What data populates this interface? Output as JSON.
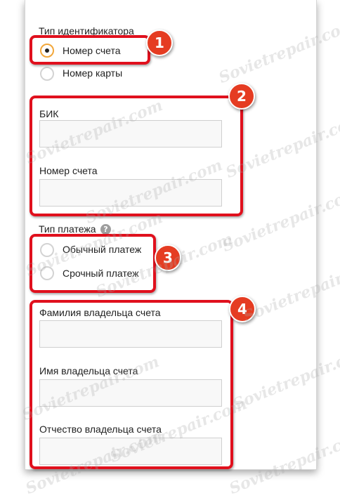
{
  "identifier_type": {
    "label": "Тип идентификатора",
    "options": [
      "Номер счета",
      "Номер карты"
    ],
    "selected": "Номер счета"
  },
  "bank_details": {
    "bik_label": "БИК",
    "bik_value": "",
    "account_label": "Номер счета",
    "account_value": ""
  },
  "payment_type": {
    "label": "Тип платежа",
    "help_glyph": "?",
    "options": [
      "Обычный платеж",
      "Срочный платеж"
    ]
  },
  "owner": {
    "last_name_label": "Фамилия владельца счета",
    "first_name_label": "Имя владельца счета",
    "patronymic_label": "Отчество владельца счета",
    "last_name_value": "",
    "first_name_value": "",
    "patronymic_value": ""
  },
  "callouts": [
    "1",
    "2",
    "3",
    "4"
  ],
  "watermark": "Sovietrepair.com",
  "colors": {
    "highlight": "#e0101d",
    "badge": "#e53c22",
    "radio_checked": "#f2a73b",
    "field_bg": "#f8f8f8",
    "field_border": "#cfcfcf"
  },
  "icons": {
    "help": "question-circle-icon"
  }
}
